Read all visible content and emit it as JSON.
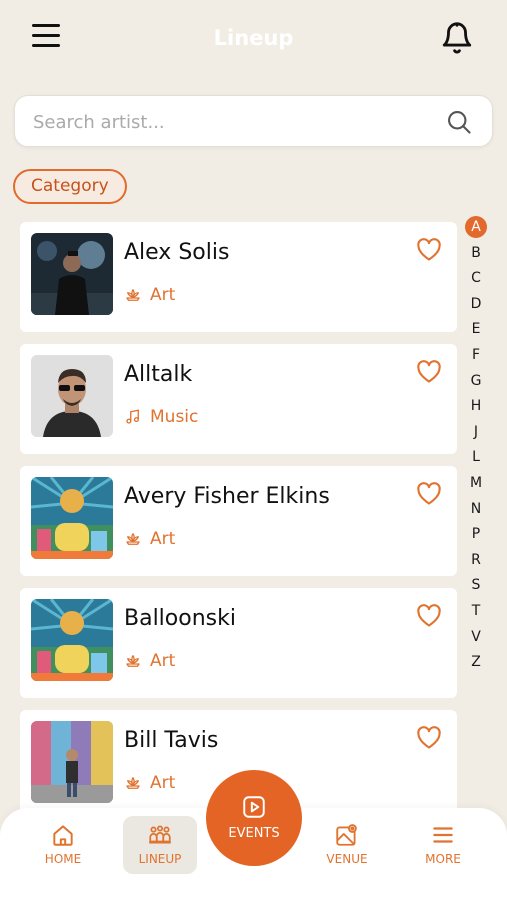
{
  "header": {
    "title": "Lineup"
  },
  "search": {
    "placeholder": "Search artist..."
  },
  "filter": {
    "category_label": "Category"
  },
  "artists": [
    {
      "name": "Alex Solis",
      "category": "Art",
      "category_icon": "lotus-icon",
      "thumb": "photo-dark-portrait"
    },
    {
      "name": "Alltalk",
      "category": "Music",
      "category_icon": "music-note-icon",
      "thumb": "photo-man-sunglasses"
    },
    {
      "name": "Avery Fisher Elkins",
      "category": "Art",
      "category_icon": "lotus-icon",
      "thumb": "festival-poster"
    },
    {
      "name": "Balloonski",
      "category": "Art",
      "category_icon": "lotus-icon",
      "thumb": "festival-poster"
    },
    {
      "name": "Bill Tavis",
      "category": "Art",
      "category_icon": "lotus-icon",
      "thumb": "photo-colorful-wall"
    }
  ],
  "alphabet": [
    "A",
    "B",
    "C",
    "D",
    "E",
    "F",
    "G",
    "H",
    "J",
    "L",
    "M",
    "N",
    "P",
    "R",
    "S",
    "T",
    "V",
    "Z"
  ],
  "alphabet_active": "A",
  "nav": {
    "home": "HOME",
    "lineup": "LINEUP",
    "events": "EVENTS",
    "venue": "VENUE",
    "more": "MORE"
  },
  "colors": {
    "accent": "#e26a2c",
    "background": "#f1ede5"
  }
}
